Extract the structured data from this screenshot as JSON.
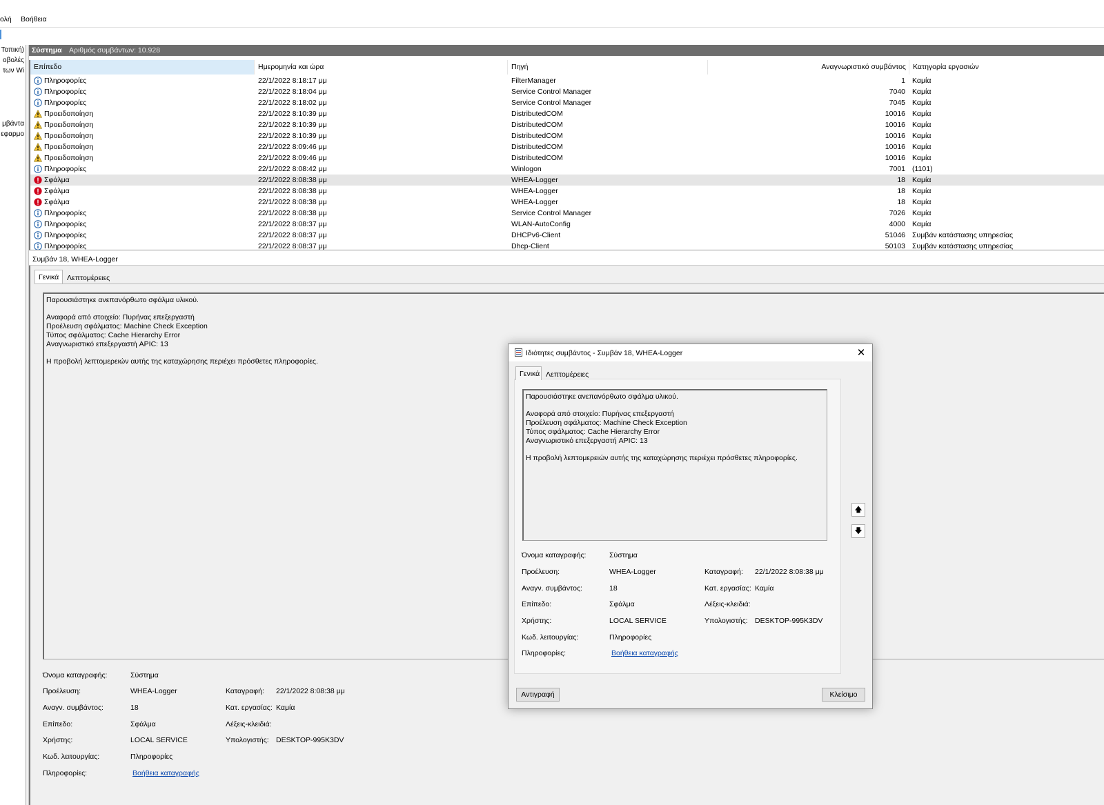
{
  "menu": {
    "view_label": "ολή",
    "help_label": "Βοήθεια"
  },
  "tree": {
    "items": [
      "Τοπική)",
      "οβολές",
      "των Wi",
      "μβάντα",
      "εφαρμο"
    ]
  },
  "list": {
    "title": "Σύστημα",
    "count_text": "Αριθμός συμβάντων: 10.928",
    "columns": {
      "level": "Επίπεδο",
      "date": "Ημερομηνία και ώρα",
      "source": "Πηγή",
      "id": "Αναγνωριστικό συμβάντος",
      "category": "Κατηγορία εργασιών"
    },
    "rows": [
      {
        "icon": "info",
        "level": "Πληροφορίες",
        "date": "22/1/2022 8:18:17 μμ",
        "source": "FilterManager",
        "id": "1",
        "category": "Καμία"
      },
      {
        "icon": "info",
        "level": "Πληροφορίες",
        "date": "22/1/2022 8:18:04 μμ",
        "source": "Service Control Manager",
        "id": "7040",
        "category": "Καμία"
      },
      {
        "icon": "info",
        "level": "Πληροφορίες",
        "date": "22/1/2022 8:18:02 μμ",
        "source": "Service Control Manager",
        "id": "7045",
        "category": "Καμία"
      },
      {
        "icon": "warning",
        "level": "Προειδοποίηση",
        "date": "22/1/2022 8:10:39 μμ",
        "source": "DistributedCOM",
        "id": "10016",
        "category": "Καμία"
      },
      {
        "icon": "warning",
        "level": "Προειδοποίηση",
        "date": "22/1/2022 8:10:39 μμ",
        "source": "DistributedCOM",
        "id": "10016",
        "category": "Καμία"
      },
      {
        "icon": "warning",
        "level": "Προειδοποίηση",
        "date": "22/1/2022 8:10:39 μμ",
        "source": "DistributedCOM",
        "id": "10016",
        "category": "Καμία"
      },
      {
        "icon": "warning",
        "level": "Προειδοποίηση",
        "date": "22/1/2022 8:09:46 μμ",
        "source": "DistributedCOM",
        "id": "10016",
        "category": "Καμία"
      },
      {
        "icon": "warning",
        "level": "Προειδοποίηση",
        "date": "22/1/2022 8:09:46 μμ",
        "source": "DistributedCOM",
        "id": "10016",
        "category": "Καμία"
      },
      {
        "icon": "info",
        "level": "Πληροφορίες",
        "date": "22/1/2022 8:08:42 μμ",
        "source": "Winlogon",
        "id": "7001",
        "category": "(1101)"
      },
      {
        "icon": "error",
        "level": "Σφάλμα",
        "date": "22/1/2022 8:08:38 μμ",
        "source": "WHEA-Logger",
        "id": "18",
        "category": "Καμία",
        "selected": true
      },
      {
        "icon": "error",
        "level": "Σφάλμα",
        "date": "22/1/2022 8:08:38 μμ",
        "source": "WHEA-Logger",
        "id": "18",
        "category": "Καμία"
      },
      {
        "icon": "error",
        "level": "Σφάλμα",
        "date": "22/1/2022 8:08:38 μμ",
        "source": "WHEA-Logger",
        "id": "18",
        "category": "Καμία"
      },
      {
        "icon": "info",
        "level": "Πληροφορίες",
        "date": "22/1/2022 8:08:38 μμ",
        "source": "Service Control Manager",
        "id": "7026",
        "category": "Καμία"
      },
      {
        "icon": "info",
        "level": "Πληροφορίες",
        "date": "22/1/2022 8:08:37 μμ",
        "source": "WLAN-AutoConfig",
        "id": "4000",
        "category": "Καμία"
      },
      {
        "icon": "info",
        "level": "Πληροφορίες",
        "date": "22/1/2022 8:08:37 μμ",
        "source": "DHCPv6-Client",
        "id": "51046",
        "category": "Συμβάν κατάστασης υπηρεσίας"
      },
      {
        "icon": "info",
        "level": "Πληροφορίες",
        "date": "22/1/2022 8:08:37 μμ",
        "source": "Dhcp-Client",
        "id": "50103",
        "category": "Συμβάν κατάστασης υπηρεσίας"
      }
    ]
  },
  "detail": {
    "title": "Συμβάν 18, WHEA-Logger",
    "tab_general": "Γενικά",
    "tab_details": "Λεπτομέρειες",
    "message_lines": [
      "Παρουσιάστηκε ανεπανόρθωτο σφάλμα υλικού.",
      "",
      "Αναφορά από στοιχείο: Πυρήνας επεξεργαστή",
      "Προέλευση σφάλματος: Machine Check Exception",
      "Τύπος σφάλματος: Cache Hierarchy Error",
      "Αναγνωριστικό επεξεργαστή APIC: 13",
      "",
      "Η προβολή λεπτομερειών αυτής της καταχώρησης περιέχει πρόσθετες πληροφορίες."
    ],
    "props": {
      "log_name_label": "Όνομα καταγραφής:",
      "log_name": "Σύστημα",
      "source_label": "Προέλευση:",
      "source": "WHEA-Logger",
      "logged_label": "Καταγραφή:",
      "logged": "22/1/2022 8:08:38 μμ",
      "event_id_label": "Αναγν. συμβάντος:",
      "event_id": "18",
      "task_cat_label": "Κατ. εργασίας:",
      "task_cat": "Καμία",
      "level_label": "Επίπεδο:",
      "level": "Σφάλμα",
      "keywords_label": "Λέξεις-κλειδιά:",
      "user_label": "Χρήστης:",
      "user": "LOCAL SERVICE",
      "computer_label": "Υπολογιστής:",
      "computer": "DESKTOP-995K3DV",
      "opcode_label": "Κωδ. λειτουργίας:",
      "opcode": "Πληροφορίες",
      "more_info_label": "Πληροφορίες:",
      "more_info_link": "Βοήθεια καταγραφής"
    }
  },
  "dialog": {
    "title": "Ιδιότητες συμβάντος - Συμβάν 18, WHEA-Logger",
    "close_glyph": "✕",
    "up_glyph": "🡅",
    "down_glyph": "🡇",
    "copy_button": "Αντιγραφή",
    "close_button": "Κλείσιμο"
  },
  "colors": {
    "titlebar": "#6d6d6d",
    "selected_header": "#d9ebf9",
    "link": "#0645ad",
    "info_icon": "#1f5fa8",
    "warning_icon": "#f1c232",
    "error_icon": "#d0021b"
  }
}
